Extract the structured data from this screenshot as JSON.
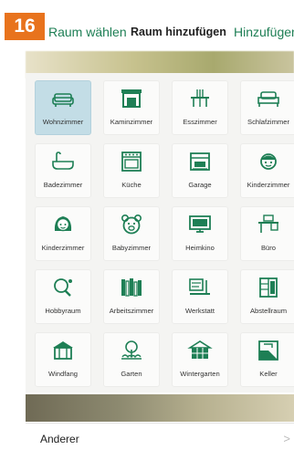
{
  "badge": "16",
  "nav": {
    "back_label": "Raum wählen",
    "title": "Raum hinzufügen",
    "action_label": "Hinzufügen"
  },
  "rooms": [
    {
      "label": "Wohnzimmer",
      "icon": "sofa-icon",
      "selected": true
    },
    {
      "label": "Kaminzimmer",
      "icon": "fireplace-icon",
      "selected": false
    },
    {
      "label": "Esszimmer",
      "icon": "dining-icon",
      "selected": false
    },
    {
      "label": "Schlafzimmer",
      "icon": "bed-icon",
      "selected": false
    },
    {
      "label": "Badezimmer",
      "icon": "bathtub-icon",
      "selected": false
    },
    {
      "label": "Küche",
      "icon": "oven-icon",
      "selected": false
    },
    {
      "label": "Garage",
      "icon": "garage-icon",
      "selected": false
    },
    {
      "label": "Kinderzimmer",
      "icon": "child-boy-icon",
      "selected": false
    },
    {
      "label": "Kinderzimmer",
      "icon": "child-girl-icon",
      "selected": false
    },
    {
      "label": "Babyzimmer",
      "icon": "teddy-bear-icon",
      "selected": false
    },
    {
      "label": "Heimkino",
      "icon": "tv-icon",
      "selected": false
    },
    {
      "label": "Büro",
      "icon": "desk-icon",
      "selected": false
    },
    {
      "label": "Hobbyraum",
      "icon": "ping-pong-icon",
      "selected": false
    },
    {
      "label": "Arbeitszimmer",
      "icon": "bookshelf-icon",
      "selected": false
    },
    {
      "label": "Werkstatt",
      "icon": "workshop-icon",
      "selected": false
    },
    {
      "label": "Abstellraum",
      "icon": "storage-icon",
      "selected": false
    },
    {
      "label": "Windfang",
      "icon": "porch-icon",
      "selected": false
    },
    {
      "label": "Garten",
      "icon": "garden-icon",
      "selected": false
    },
    {
      "label": "Wintergarten",
      "icon": "conservatory-icon",
      "selected": false
    },
    {
      "label": "Keller",
      "icon": "basement-icon",
      "selected": false
    }
  ],
  "other": {
    "label": "Anderer",
    "chevron": ">"
  },
  "colors": {
    "accent": "#1e7f55",
    "badge": "#e8731d",
    "selected": "#c3dde6"
  }
}
